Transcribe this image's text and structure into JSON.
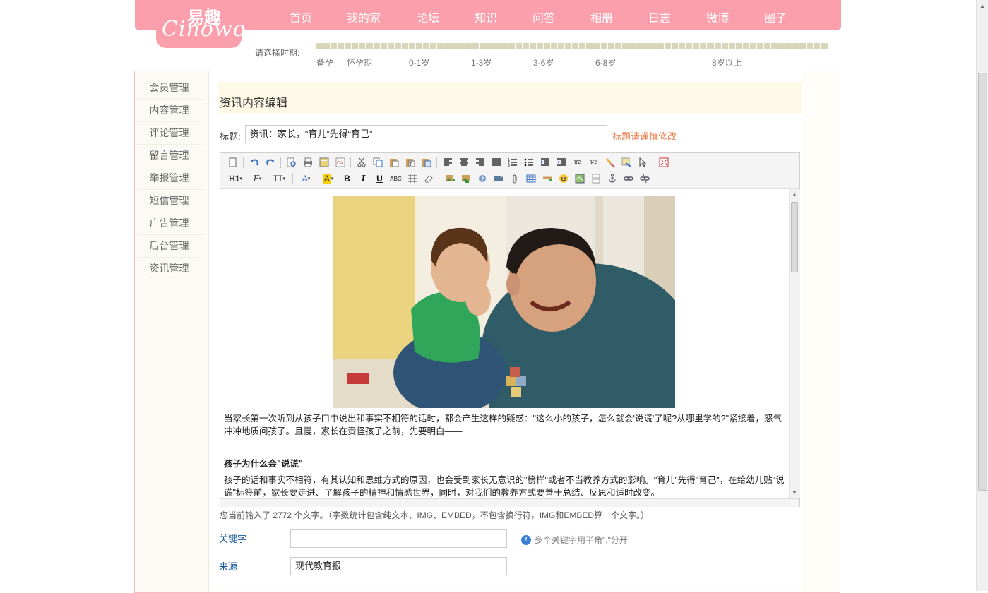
{
  "logo": {
    "cn": "易趣",
    "en": "Cinowo"
  },
  "nav": [
    "首页",
    "我的家",
    "论坛",
    "知识",
    "问答",
    "相册",
    "日志",
    "微博",
    "圈子"
  ],
  "period": {
    "label": "请选择时期:",
    "stages": [
      "备孕",
      "怀孕期",
      "0-1岁",
      "1-3岁",
      "3-6岁",
      "6-8岁",
      "8岁以上"
    ]
  },
  "sidebar": [
    "会员管理",
    "内容管理",
    "评论管理",
    "留言管理",
    "举报管理",
    "短信管理",
    "广告管理",
    "后台管理",
    "资讯管理"
  ],
  "section_title": "资讯内容编辑",
  "form": {
    "title_label": "标题:",
    "title_value": "资讯：家长，“育儿”先得“育己”",
    "title_warning": "标题请谨慎修改",
    "keyword_label": "关键字",
    "keyword_value": "",
    "keyword_hint": "多个关键字用半角\",\"分开",
    "source_label": "来源",
    "source_value": "现代教育报"
  },
  "toolbar": {
    "row1": [
      "source-icon",
      "undo-icon",
      "redo-icon",
      "preview-icon",
      "print-icon",
      "template-icon",
      "code-icon",
      "cut-icon",
      "copy-icon",
      "paste-icon",
      "paste-text-icon",
      "paste-word-icon",
      "align-left-icon",
      "align-center-icon",
      "align-right-icon",
      "justify-icon",
      "ordered-list-icon",
      "unordered-list-icon",
      "indent-icon",
      "outdent-icon",
      "subscript-icon",
      "superscript-icon",
      "format-brush-icon",
      "clear-format-icon",
      "select-all-icon",
      "fullscreen-icon"
    ],
    "row2": [
      "heading-icon",
      "font-family-icon",
      "font-size-icon",
      "font-color-icon",
      "highlight-icon",
      "bold-icon",
      "italic-icon",
      "underline-icon",
      "strikethrough-icon",
      "line-height-icon",
      "eraser-icon",
      "image-icon",
      "multi-image-icon",
      "flash-icon",
      "media-icon",
      "attachment-icon",
      "table-icon",
      "hr-icon",
      "emoticon-icon",
      "map-icon",
      "page-break-icon",
      "anchor-icon",
      "link-icon",
      "unlink-icon"
    ],
    "glyphs": {
      "heading": "H1",
      "font_family": "F",
      "font_size": "TT",
      "font_color": "A",
      "highlight": "A",
      "bold": "B",
      "italic": "I",
      "underline": "U",
      "strike": "ABC"
    }
  },
  "editor": {
    "para1": "当家长第一次听到从孩子口中说出和事实不相符的话时，都会产生这样的疑惑：\"这么小的孩子，怎么就会'说谎'了呢?从哪里学的?\"紧接着，怒气冲冲地质问孩子。且慢，家长在责怪孩子之前，先要明白——",
    "heading": "孩子为什么会\"说谎\"",
    "para2": "孩子的话和事实不相符，有其认知和思维方式的原因，也会受到家长无意识的\"榜样\"或者不当教养方式的影响。\"育儿\"先得\"育己\"，在给幼儿贴\"说谎\"标签前，家长要走进、了解孩子的精神和情感世界，同时，对我们的教养方式要善于总结、反思和适时改变。"
  },
  "word_count": "您当前输入了 2772 个文字。（字数统计包含纯文本、IMG、EMBED，不包含换行符，IMG和EMBED算一个文字。）",
  "colors": {
    "brand_pink": "#fb9fad",
    "accent_orange": "#e87e4d",
    "link_blue": "#1a5aa0"
  }
}
